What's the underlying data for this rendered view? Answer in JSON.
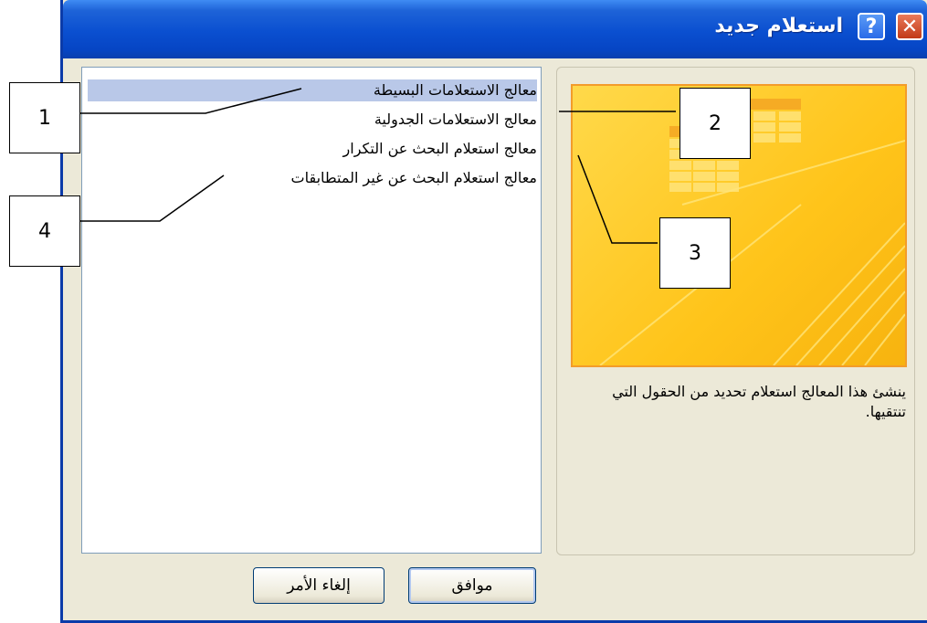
{
  "window": {
    "title": "استعلام جديد",
    "help_glyph": "?",
    "close_glyph": "✕"
  },
  "query_types": [
    {
      "label": "معالج الاستعلامات البسيطة",
      "selected": true
    },
    {
      "label": "معالج الاستعلامات الجدولية",
      "selected": false
    },
    {
      "label": "معالج استعلام البحث عن التكرار",
      "selected": false
    },
    {
      "label": "معالج استعلام البحث عن غير المتطابقات",
      "selected": false
    }
  ],
  "description": "ينشئ هذا المعالج استعلام تحديد من الحقول التي تنتقيها.",
  "buttons": {
    "ok": "موافق",
    "cancel": "إلغاء الأمر"
  },
  "callouts": [
    "1",
    "2",
    "3",
    "4"
  ],
  "colors": {
    "titlebar": "#0a4fd0",
    "selection": "#b9c8e8",
    "preview_bg": "#ffc41a"
  }
}
